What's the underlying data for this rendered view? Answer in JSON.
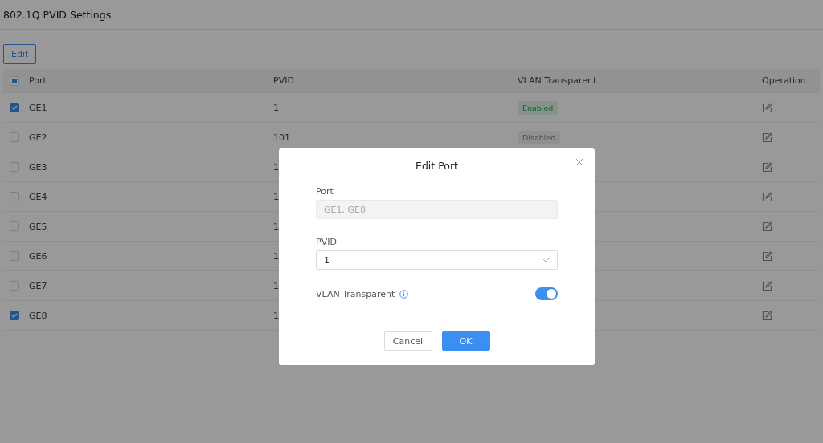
{
  "page": {
    "title": "802.1Q PVID Settings"
  },
  "toolbar": {
    "edit_button": "Edit"
  },
  "table": {
    "header_checkbox": {
      "indeterminate": true
    },
    "columns": [
      "Port",
      "PVID",
      "VLAN Transparent",
      "Operation"
    ],
    "rows": [
      {
        "checked": true,
        "port": "GE1",
        "pvid": "1",
        "vlan_transparent": {
          "label": "Enabled",
          "enabled": true
        }
      },
      {
        "checked": false,
        "port": "GE2",
        "pvid": "101",
        "vlan_transparent": {
          "label": "Disabled",
          "enabled": false
        }
      },
      {
        "checked": false,
        "port": "GE3",
        "pvid": "1"
      },
      {
        "checked": false,
        "port": "GE4",
        "pvid": "1"
      },
      {
        "checked": false,
        "port": "GE5",
        "pvid": "1"
      },
      {
        "checked": false,
        "port": "GE6",
        "pvid": "1"
      },
      {
        "checked": false,
        "port": "GE7",
        "pvid": "1"
      },
      {
        "checked": true,
        "port": "GE8",
        "pvid": "1"
      }
    ]
  },
  "dialog": {
    "title": "Edit Port",
    "port": {
      "label": "Port",
      "value": "GE1, GE8",
      "disabled": true
    },
    "pvid": {
      "label": "PVID",
      "value": "1"
    },
    "vlan_transparent": {
      "label": "VLAN Transparent",
      "on": true
    },
    "buttons": [
      {
        "label": "Cancel",
        "kind": "secondary"
      },
      {
        "label": "OK",
        "kind": "primary"
      }
    ]
  }
}
